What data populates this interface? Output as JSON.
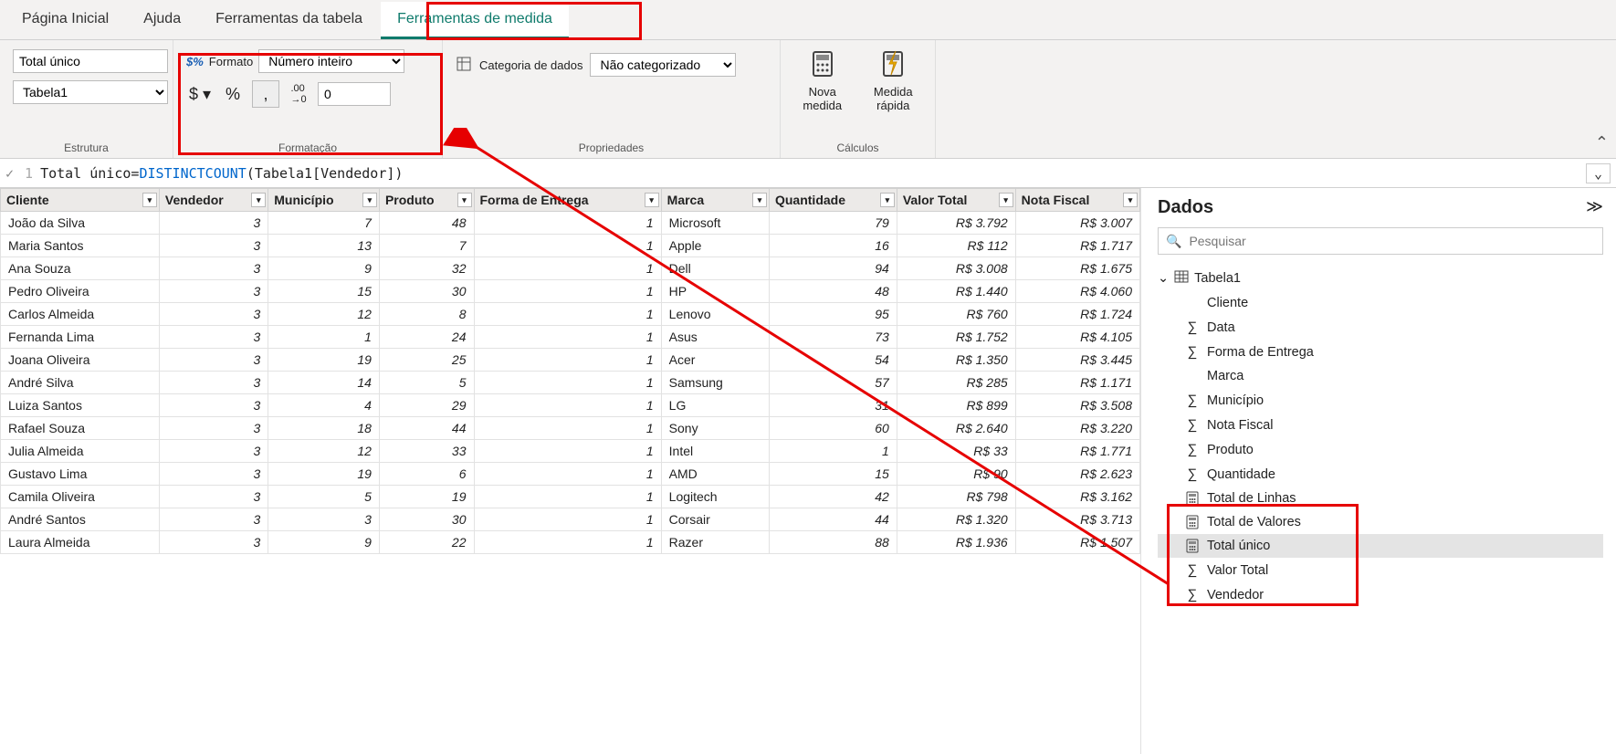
{
  "tabs": {
    "home": "Página Inicial",
    "help": "Ajuda",
    "table_tools": "Ferramentas da tabela",
    "measure_tools": "Ferramentas de medida"
  },
  "structure_group": {
    "measure_name": "Total único",
    "table_name": "Tabela1",
    "label": "Estrutura"
  },
  "formatting_group": {
    "label": "Formatação",
    "format_label": "Formato",
    "format_value": "Número inteiro",
    "decimal_value": "0",
    "currency_symbol": "$",
    "percent_symbol": "%",
    "thousands_symbol": ",",
    "decimal_increase_symbol": ".00→0"
  },
  "properties_group": {
    "label": "Propriedades",
    "category_label": "Categoria de dados",
    "category_value": "Não categorizado"
  },
  "calculations_group": {
    "label": "Cálculos",
    "new_measure": "Nova medida",
    "quick_measure": "Medida rápida"
  },
  "formula": {
    "line": "1",
    "name": "Total único",
    "eq": " = ",
    "func": "DISTINCTCOUNT",
    "arg_open": "(Tabela1[Vendedor])"
  },
  "grid": {
    "columns": [
      "Cliente",
      "Vendedor",
      "Município",
      "Produto",
      "Forma de Entrega",
      "Marca",
      "Quantidade",
      "Valor Total",
      "Nota Fiscal"
    ],
    "rows": [
      {
        "cliente": "João da Silva",
        "vendedor": "3",
        "municipio": "7",
        "produto": "48",
        "entrega": "1",
        "marca": "Microsoft",
        "qtd": "79",
        "valor": "R$ 3.792",
        "nota": "R$ 3.007"
      },
      {
        "cliente": "Maria Santos",
        "vendedor": "3",
        "municipio": "13",
        "produto": "7",
        "entrega": "1",
        "marca": "Apple",
        "qtd": "16",
        "valor": "R$ 112",
        "nota": "R$ 1.717"
      },
      {
        "cliente": "Ana Souza",
        "vendedor": "3",
        "municipio": "9",
        "produto": "32",
        "entrega": "1",
        "marca": "Dell",
        "qtd": "94",
        "valor": "R$ 3.008",
        "nota": "R$ 1.675"
      },
      {
        "cliente": "Pedro Oliveira",
        "vendedor": "3",
        "municipio": "15",
        "produto": "30",
        "entrega": "1",
        "marca": "HP",
        "qtd": "48",
        "valor": "R$ 1.440",
        "nota": "R$ 4.060"
      },
      {
        "cliente": "Carlos Almeida",
        "vendedor": "3",
        "municipio": "12",
        "produto": "8",
        "entrega": "1",
        "marca": "Lenovo",
        "qtd": "95",
        "valor": "R$ 760",
        "nota": "R$ 1.724"
      },
      {
        "cliente": "Fernanda Lima",
        "vendedor": "3",
        "municipio": "1",
        "produto": "24",
        "entrega": "1",
        "marca": "Asus",
        "qtd": "73",
        "valor": "R$ 1.752",
        "nota": "R$ 4.105"
      },
      {
        "cliente": "Joana Oliveira",
        "vendedor": "3",
        "municipio": "19",
        "produto": "25",
        "entrega": "1",
        "marca": "Acer",
        "qtd": "54",
        "valor": "R$ 1.350",
        "nota": "R$ 3.445"
      },
      {
        "cliente": "André Silva",
        "vendedor": "3",
        "municipio": "14",
        "produto": "5",
        "entrega": "1",
        "marca": "Samsung",
        "qtd": "57",
        "valor": "R$ 285",
        "nota": "R$ 1.171"
      },
      {
        "cliente": "Luiza Santos",
        "vendedor": "3",
        "municipio": "4",
        "produto": "29",
        "entrega": "1",
        "marca": "LG",
        "qtd": "31",
        "valor": "R$ 899",
        "nota": "R$ 3.508"
      },
      {
        "cliente": "Rafael Souza",
        "vendedor": "3",
        "municipio": "18",
        "produto": "44",
        "entrega": "1",
        "marca": "Sony",
        "qtd": "60",
        "valor": "R$ 2.640",
        "nota": "R$ 3.220"
      },
      {
        "cliente": "Julia Almeida",
        "vendedor": "3",
        "municipio": "12",
        "produto": "33",
        "entrega": "1",
        "marca": "Intel",
        "qtd": "1",
        "valor": "R$ 33",
        "nota": "R$ 1.771"
      },
      {
        "cliente": "Gustavo Lima",
        "vendedor": "3",
        "municipio": "19",
        "produto": "6",
        "entrega": "1",
        "marca": "AMD",
        "qtd": "15",
        "valor": "R$ 90",
        "nota": "R$ 2.623"
      },
      {
        "cliente": "Camila Oliveira",
        "vendedor": "3",
        "municipio": "5",
        "produto": "19",
        "entrega": "1",
        "marca": "Logitech",
        "qtd": "42",
        "valor": "R$ 798",
        "nota": "R$ 3.162"
      },
      {
        "cliente": "André Santos",
        "vendedor": "3",
        "municipio": "3",
        "produto": "30",
        "entrega": "1",
        "marca": "Corsair",
        "qtd": "44",
        "valor": "R$ 1.320",
        "nota": "R$ 3.713"
      },
      {
        "cliente": "Laura Almeida",
        "vendedor": "3",
        "municipio": "9",
        "produto": "22",
        "entrega": "1",
        "marca": "Razer",
        "qtd": "88",
        "valor": "R$ 1.936",
        "nota": "R$ 1.507"
      }
    ]
  },
  "fields_pane": {
    "title": "Dados",
    "search_placeholder": "Pesquisar",
    "table": "Tabela1",
    "fields": [
      {
        "name": "Cliente",
        "kind": "text"
      },
      {
        "name": "Data",
        "kind": "sigma"
      },
      {
        "name": "Forma de Entrega",
        "kind": "sigma"
      },
      {
        "name": "Marca",
        "kind": "text"
      },
      {
        "name": "Município",
        "kind": "sigma"
      },
      {
        "name": "Nota Fiscal",
        "kind": "sigma"
      },
      {
        "name": "Produto",
        "kind": "sigma"
      },
      {
        "name": "Quantidade",
        "kind": "sigma"
      },
      {
        "name": "Total de Linhas",
        "kind": "measure"
      },
      {
        "name": "Total de Valores",
        "kind": "measure"
      },
      {
        "name": "Total único",
        "kind": "measure",
        "selected": true
      },
      {
        "name": "Valor Total",
        "kind": "sigma"
      },
      {
        "name": "Vendedor",
        "kind": "sigma"
      }
    ]
  }
}
